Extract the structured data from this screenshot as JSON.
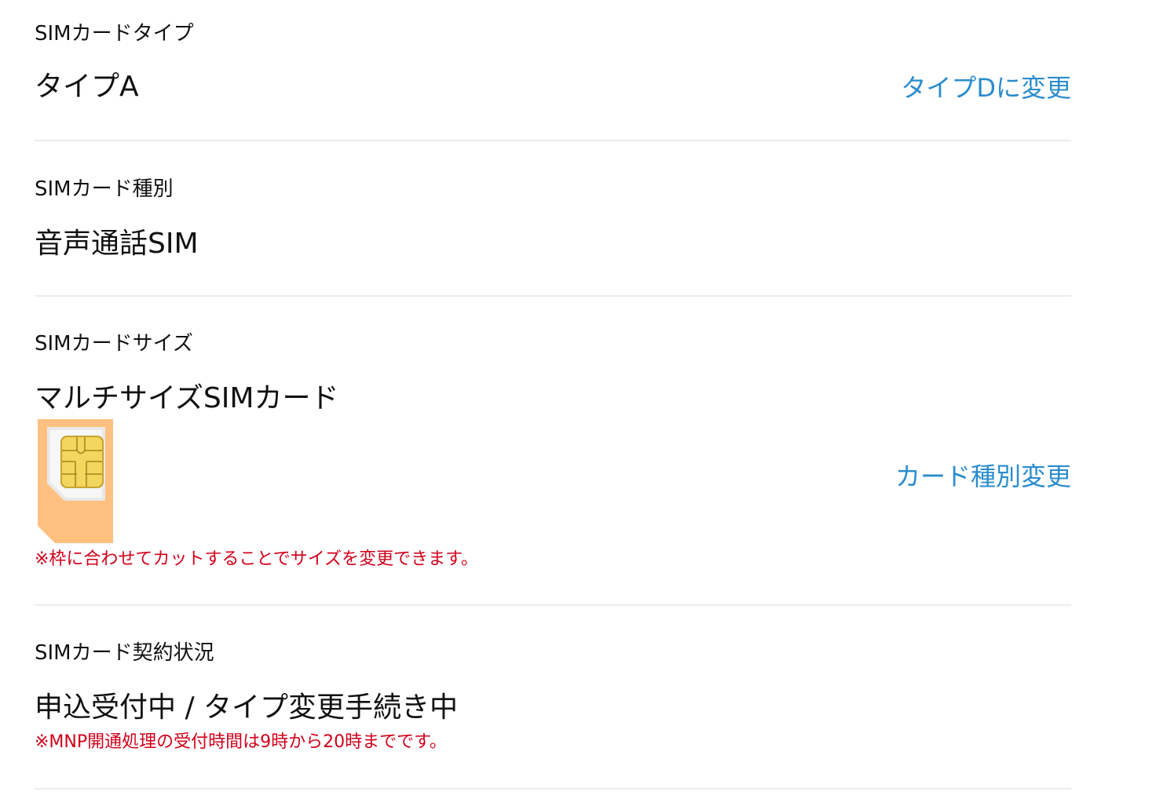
{
  "sections": [
    {
      "label": "SIMカードタイプ",
      "value": "タイプA",
      "action": "タイプDに変更"
    },
    {
      "label": "SIMカード種別",
      "value": "音声通話SIM"
    },
    {
      "label": "SIMカードサイズ",
      "value": "マルチサイズSIMカード",
      "image_icon": "multi-size-sim-card-icon",
      "action": "カード種別変更",
      "note": "※枠に合わせてカットすることでサイズを変更できます。"
    },
    {
      "label": "SIMカード契約状況",
      "value": "申込受付中 / タイプ変更手続き中",
      "note": "※MNP開通処理の受付時間は9時から20時までです。"
    }
  ],
  "colors": {
    "link": "#2a8ccd",
    "note": "#d0021b",
    "text": "#111111",
    "divider": "#ececec",
    "sim_outer": "#ffc080",
    "sim_chip": "#f1cf55"
  }
}
